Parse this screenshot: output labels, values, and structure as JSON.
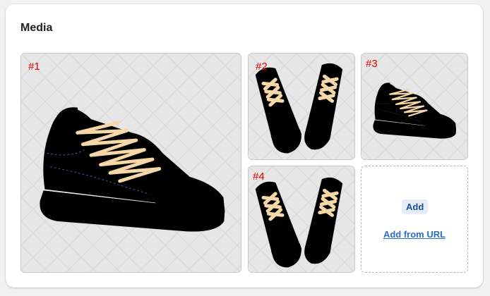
{
  "media": {
    "title": "Media",
    "tiles": [
      {
        "number": "#1",
        "color": "blue",
        "view": "side"
      },
      {
        "number": "#2",
        "color": "blue",
        "view": "pair-top"
      },
      {
        "number": "#3",
        "color": "tan",
        "view": "side"
      },
      {
        "number": "#4",
        "color": "tan",
        "view": "pair-top"
      }
    ],
    "add_label": "Add",
    "add_from_url_label": "Add from URL"
  },
  "colors": {
    "number_red": "#e30000",
    "shoe_blue": "#5b8fd6",
    "shoe_tan": "#c9a35a",
    "lace": "#f6d7a8",
    "link_blue": "#2c6ecb"
  }
}
